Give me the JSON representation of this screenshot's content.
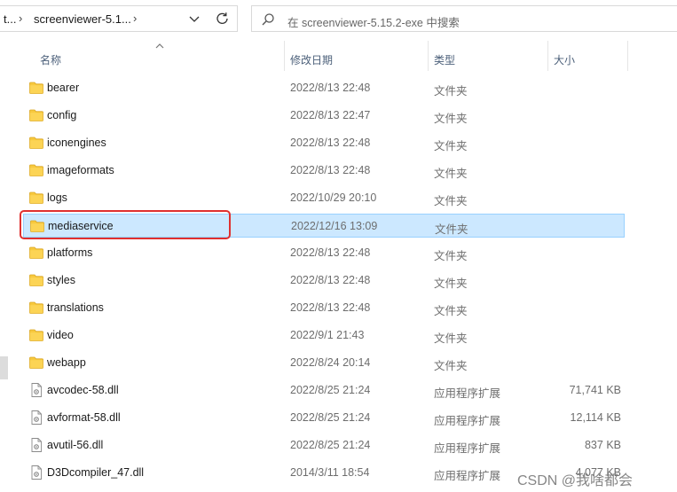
{
  "address": {
    "prev_crumb": "t...",
    "current_crumb": "screenviewer-5.1...",
    "separator": "›"
  },
  "search": {
    "placeholder": "在 screenviewer-5.15.2-exe 中搜索"
  },
  "columns": {
    "name": "名称",
    "date": "修改日期",
    "type": "类型",
    "size": "大小"
  },
  "rows": [
    {
      "name": "bearer",
      "date": "2022/8/13 22:48",
      "type": "文件夹",
      "size": "",
      "kind": "folder"
    },
    {
      "name": "config",
      "date": "2022/8/13 22:47",
      "type": "文件夹",
      "size": "",
      "kind": "folder"
    },
    {
      "name": "iconengines",
      "date": "2022/8/13 22:48",
      "type": "文件夹",
      "size": "",
      "kind": "folder"
    },
    {
      "name": "imageformats",
      "date": "2022/8/13 22:48",
      "type": "文件夹",
      "size": "",
      "kind": "folder"
    },
    {
      "name": "logs",
      "date": "2022/10/29 20:10",
      "type": "文件夹",
      "size": "",
      "kind": "folder"
    },
    {
      "name": "mediaservice",
      "date": "2022/12/16 13:09",
      "type": "文件夹",
      "size": "",
      "kind": "folder",
      "selected": true
    },
    {
      "name": "platforms",
      "date": "2022/8/13 22:48",
      "type": "文件夹",
      "size": "",
      "kind": "folder"
    },
    {
      "name": "styles",
      "date": "2022/8/13 22:48",
      "type": "文件夹",
      "size": "",
      "kind": "folder"
    },
    {
      "name": "translations",
      "date": "2022/8/13 22:48",
      "type": "文件夹",
      "size": "",
      "kind": "folder"
    },
    {
      "name": "video",
      "date": "2022/9/1 21:43",
      "type": "文件夹",
      "size": "",
      "kind": "folder"
    },
    {
      "name": "webapp",
      "date": "2022/8/24 20:14",
      "type": "文件夹",
      "size": "",
      "kind": "folder"
    },
    {
      "name": "avcodec-58.dll",
      "date": "2022/8/25 21:24",
      "type": "应用程序扩展",
      "size": "71,741 KB",
      "kind": "dll"
    },
    {
      "name": "avformat-58.dll",
      "date": "2022/8/25 21:24",
      "type": "应用程序扩展",
      "size": "12,114 KB",
      "kind": "dll"
    },
    {
      "name": "avutil-56.dll",
      "date": "2022/8/25 21:24",
      "type": "应用程序扩展",
      "size": "837 KB",
      "kind": "dll"
    },
    {
      "name": "D3Dcompiler_47.dll",
      "date": "2014/3/11 18:54",
      "type": "应用程序扩展",
      "size": "4,077 KB",
      "kind": "dll"
    }
  ],
  "icons": {
    "folder": "folder-icon",
    "dll": "dll-file-icon",
    "search": "search-icon",
    "refresh": "refresh-icon",
    "dropdown": "chevron-down-icon"
  },
  "colors": {
    "selected_bg": "#cce8ff",
    "selected_border": "#99d1ff",
    "annotation_red": "#e0302f",
    "folder_yellow": "#f8c93e"
  },
  "watermark": "CSDN @我啥都会"
}
